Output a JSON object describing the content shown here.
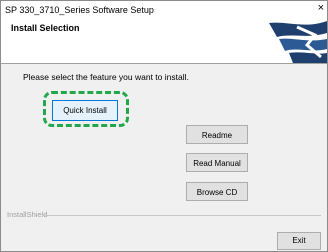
{
  "window": {
    "title": "SP 330_3710_Series Software Setup",
    "close_glyph": "×"
  },
  "header": {
    "section_title": "Install Selection",
    "logo_icon": "setup-swoosh-logo-icon",
    "logo_color": "#1f3f6e"
  },
  "main": {
    "prompt": "Please select the feature you want to install.",
    "buttons": [
      {
        "label": "Quick Install"
      },
      {
        "label": "Readme"
      },
      {
        "label": "Read Manual"
      },
      {
        "label": "Browse CD"
      }
    ],
    "highlight_color": "#22a84b"
  },
  "footer": {
    "brand": "InstallShield",
    "exit_label": "Exit"
  }
}
